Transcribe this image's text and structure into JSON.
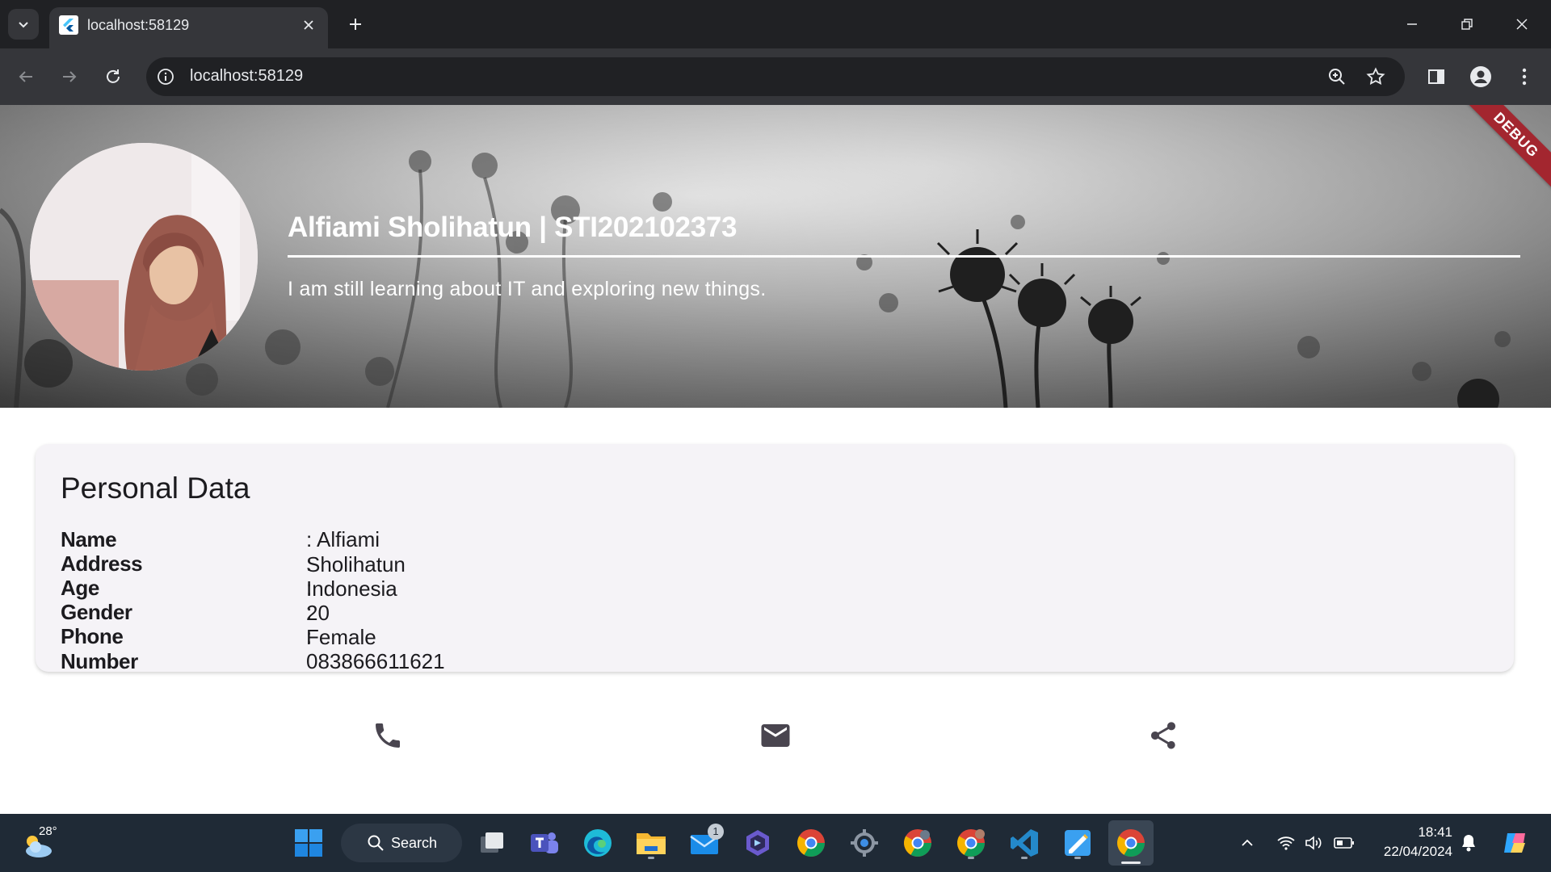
{
  "browser": {
    "tab_title": "localhost:58129",
    "url": "localhost:58129"
  },
  "profile": {
    "name_line": "Alfiami Sholihatun | STI202102373",
    "tagline": "I am still learning about IT and exploring new things.",
    "debug_badge": "DEBUG"
  },
  "personal_data": {
    "title": "Personal Data",
    "rows": [
      {
        "label": "Name",
        "value": ": Alfiami Sholihatun"
      },
      {
        "label": "Address",
        "value": ": Indonesia"
      },
      {
        "label": "Age",
        "value": ": 20"
      },
      {
        "label": "Gender",
        "value": ": Female"
      },
      {
        "label": "Phone Number",
        "value": ": 083866611621"
      }
    ]
  },
  "actions": {
    "icons": [
      "phone-icon",
      "mail-icon",
      "share-icon"
    ]
  },
  "taskbar": {
    "weather_temp": "28°",
    "search_label": "Search",
    "mail_badge": "1",
    "time": "18:41",
    "date": "22/04/2024"
  },
  "colors": {
    "browser_dark": "#202124",
    "toolbar": "#35363a",
    "card_bg": "#f5f3f7",
    "debug_ribbon": "#a3262f",
    "action_icon": "#49454f",
    "taskbar": "#1f2a36"
  }
}
